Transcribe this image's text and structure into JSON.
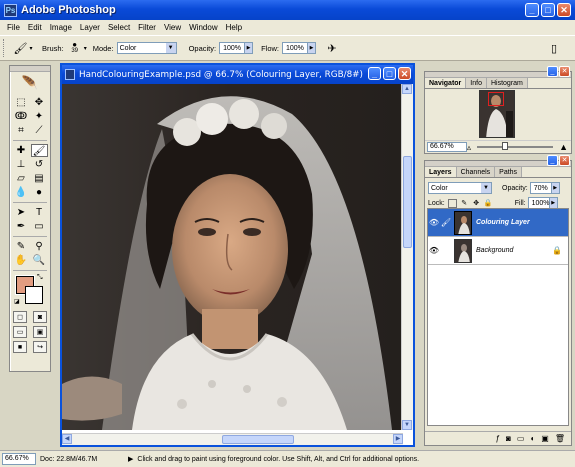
{
  "app": {
    "title": "Adobe Photoshop",
    "icon": "photoshop-icon"
  },
  "window_buttons": {
    "minimize": "_",
    "maximize": "□",
    "close": "✕"
  },
  "menu": [
    "File",
    "Edit",
    "Image",
    "Layer",
    "Select",
    "Filter",
    "View",
    "Window",
    "Help"
  ],
  "options": {
    "brush_label": "Brush:",
    "brush_size": "39",
    "mode_label": "Mode:",
    "mode_value": "Color",
    "opacity_label": "Opacity:",
    "opacity_value": "100%",
    "flow_label": "Flow:",
    "flow_value": "100%"
  },
  "document": {
    "title": "HandColouringExample.psd @ 66.7% (Colouring Layer, RGB/8#)"
  },
  "navigator": {
    "tabs": [
      "Navigator",
      "Info",
      "Histogram"
    ],
    "zoom": "66.67%",
    "slider_level": 0.35
  },
  "layers": {
    "tabs": [
      "Layers",
      "Channels",
      "Paths"
    ],
    "blend_mode": "Color",
    "opacity_label": "Opacity:",
    "opacity_value": "70%",
    "lock_label": "Lock:",
    "fill_label": "Fill:",
    "fill_value": "100%",
    "items": [
      {
        "name": "Colouring Layer",
        "selected": true
      },
      {
        "name": "Background",
        "selected": false,
        "locked": true
      }
    ]
  },
  "status": {
    "zoom": "66.67%",
    "doc": "Doc: 22.8M/46.7M",
    "hint": "Click and drag to paint using foreground color.  Use Shift, Alt, and Ctrl for additional options."
  },
  "colors": {
    "title_bar": "#0a4ad8",
    "foreground": "#e29c80",
    "background": "#ffffff",
    "selected_layer": "#3169c6"
  },
  "tools": [
    "marquee-tool",
    "move-tool",
    "lasso-tool",
    "magic-wand-tool",
    "crop-tool",
    "slice-tool",
    "healing-brush-tool",
    "brush-tool",
    "clone-stamp-tool",
    "history-brush-tool",
    "eraser-tool",
    "gradient-tool",
    "blur-tool",
    "dodge-tool",
    "path-selection-tool",
    "type-tool",
    "pen-tool",
    "shape-tool",
    "notes-tool",
    "eyedropper-tool",
    "hand-tool",
    "zoom-tool"
  ]
}
